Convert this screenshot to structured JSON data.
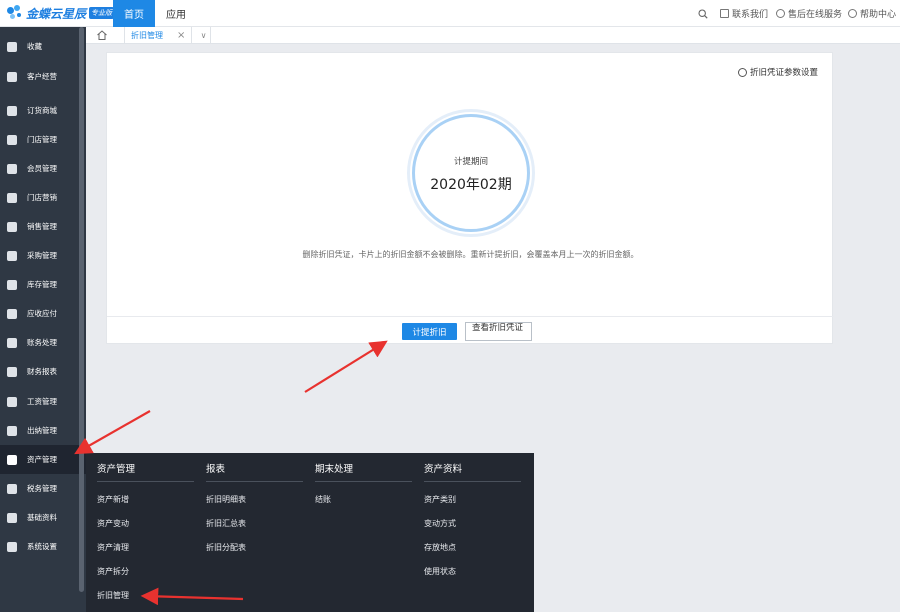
{
  "topbar": {
    "logo_text": "金蝶云星辰",
    "logo_badge": "专业版",
    "nav_home": "首页",
    "nav_app": "应用",
    "contact": "联系我们",
    "service": "售后在线服务",
    "help": "帮助中心"
  },
  "sidebar": {
    "items": [
      {
        "label": "收藏",
        "icon": "star-icon"
      },
      {
        "label": "客户经营",
        "icon": "user-icon"
      },
      {
        "label": "订货商城",
        "icon": "shop-icon"
      },
      {
        "label": "门店管理",
        "icon": "store-icon"
      },
      {
        "label": "会员管理",
        "icon": "diamond-icon"
      },
      {
        "label": "门店营销",
        "icon": "tag-icon"
      },
      {
        "label": "销售管理",
        "icon": "bar-chart-icon"
      },
      {
        "label": "采购管理",
        "icon": "cart-icon"
      },
      {
        "label": "库存管理",
        "icon": "box-icon"
      },
      {
        "label": "应收应付",
        "icon": "coin-icon"
      },
      {
        "label": "账务处理",
        "icon": "ledger-icon"
      },
      {
        "label": "财务报表",
        "icon": "report-icon"
      },
      {
        "label": "工资管理",
        "icon": "salary-icon"
      },
      {
        "label": "出纳管理",
        "icon": "cashier-icon"
      },
      {
        "label": "资产管理",
        "icon": "asset-icon"
      },
      {
        "label": "税务管理",
        "icon": "tax-icon"
      },
      {
        "label": "基础资料",
        "icon": "layers-icon"
      },
      {
        "label": "系统设置",
        "icon": "gear-icon"
      }
    ]
  },
  "tabs": {
    "active_label": "折旧管理",
    "close_glyph": "×",
    "dropdown_glyph": "∨"
  },
  "card": {
    "param_link": "折旧凭证参数设置",
    "period_label": "计提期间",
    "period_value": "2020年02期",
    "notice": "删除折旧凭证，卡片上的折旧金额不会被删除。重新计提折旧，会覆盖本月上一次的折旧金额。",
    "primary_button": "计提折旧",
    "secondary_button": "查看折旧凭证"
  },
  "flyout": {
    "columns": [
      {
        "header": "资产管理",
        "items": [
          "资产新增",
          "资产变动",
          "资产清理",
          "资产拆分",
          "折旧管理"
        ]
      },
      {
        "header": "报表",
        "items": [
          "折旧明细表",
          "折旧汇总表",
          "折旧分配表"
        ]
      },
      {
        "header": "期末处理",
        "items": [
          "结账"
        ]
      },
      {
        "header": "资产资料",
        "items": [
          "资产类别",
          "变动方式",
          "存放地点",
          "使用状态"
        ]
      }
    ]
  },
  "colors": {
    "accent": "#1e88e5",
    "sidebar_bg": "#2f3844",
    "flyout_bg": "#232831",
    "arrow": "#e8322f"
  }
}
